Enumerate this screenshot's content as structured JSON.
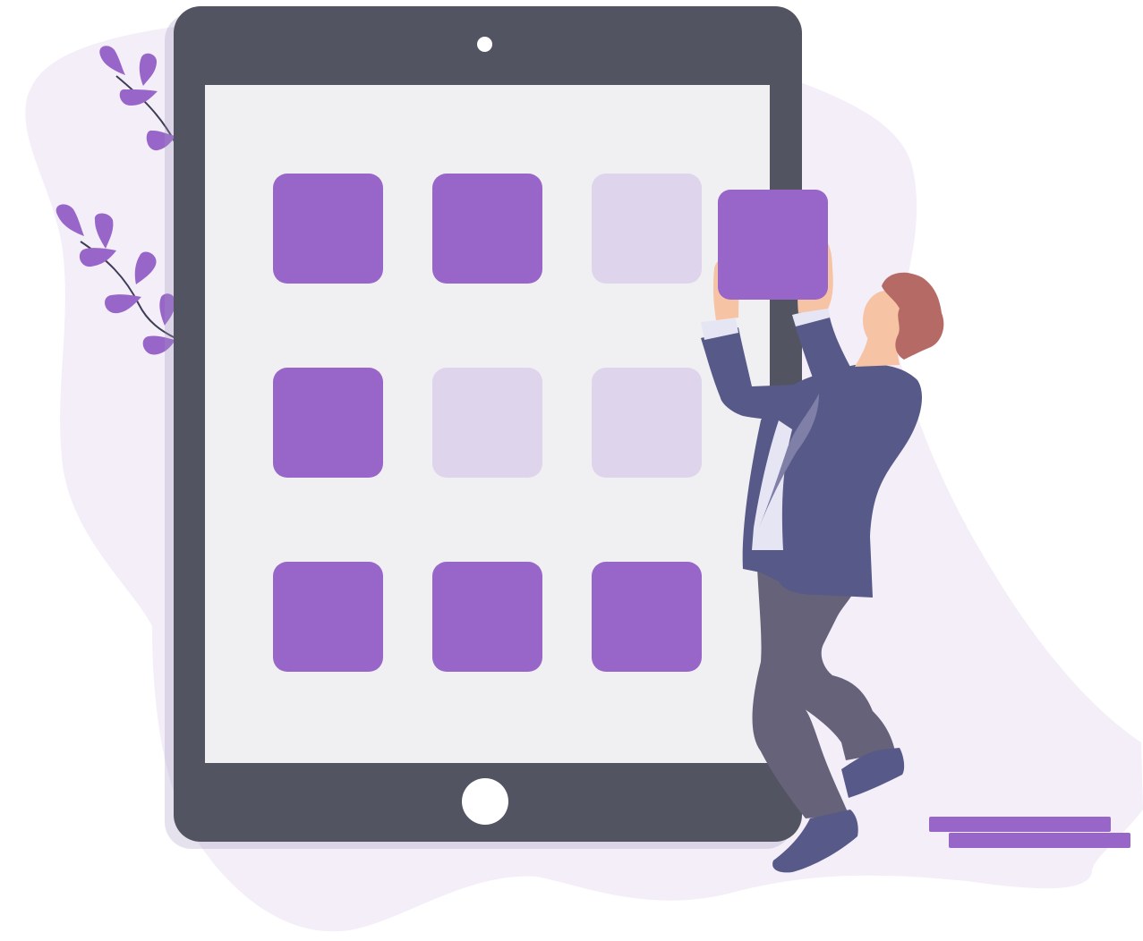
{
  "colors": {
    "background_blob": "#f3eef8",
    "tablet_body": "#535461",
    "tablet_screen": "#f0f0f2",
    "tile_active": "#9866c9",
    "tile_inactive": "#ded5ec",
    "leaf": "#9866c9",
    "stem": "#3f3d56",
    "suit": "#575988",
    "suit_shadow": "#4a4b78",
    "pants": "#65627a",
    "shoes": "#575988",
    "skin": "#f6c3a4",
    "hair": "#b66a66",
    "shirt": "#e6e5f3",
    "tie": "#7f7fa8"
  },
  "icons": [
    "plant-icon",
    "person-illustration"
  ],
  "tiles": [
    {
      "state": "active"
    },
    {
      "state": "active"
    },
    {
      "state": "inactive"
    },
    {
      "state": "active"
    },
    {
      "state": "inactive"
    },
    {
      "state": "inactive"
    },
    {
      "state": "active"
    },
    {
      "state": "active"
    },
    {
      "state": "active"
    }
  ],
  "held_tile": {
    "state": "active"
  }
}
